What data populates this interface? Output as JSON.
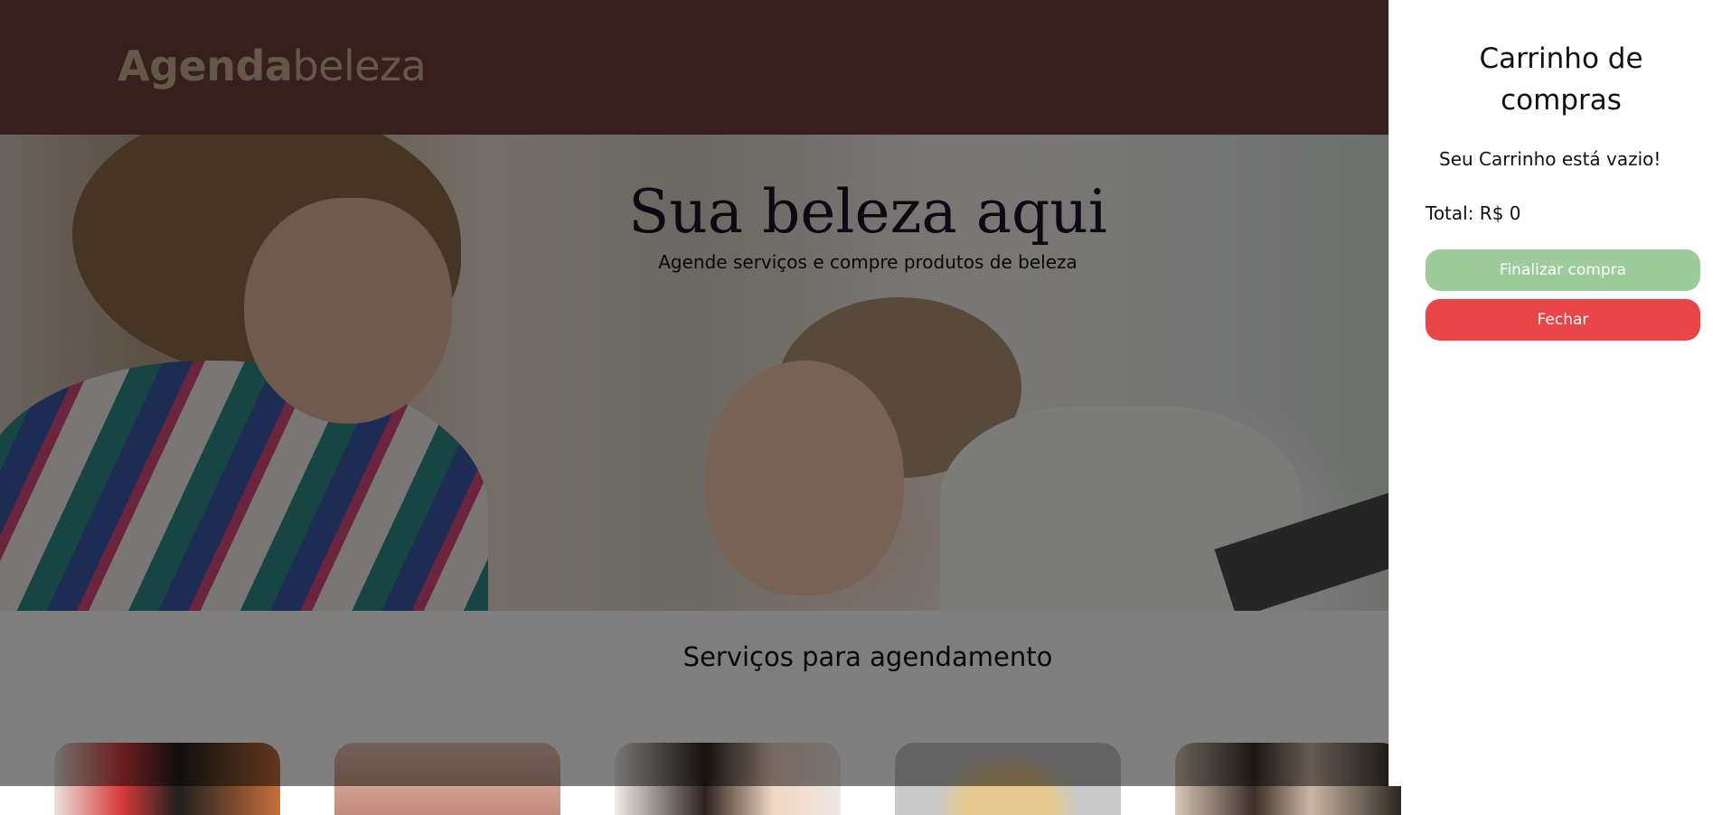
{
  "header": {
    "logo_bold": "Agenda",
    "logo_light": "beleza",
    "background": "#733d3c",
    "logo_color": "#c8b18e"
  },
  "hero": {
    "title": "Sua beleza aqui",
    "subtitle": "Agende serviços e compre produtos de beleza"
  },
  "services": {
    "title": "Serviços para agendamento"
  },
  "cart": {
    "title": "Carrinho de compras",
    "empty_message": "Seu Carrinho está vazio!",
    "total_label": "Total: R$ 0",
    "finalize_label": "Finalizar compra",
    "close_label": "Fechar",
    "finalize_color": "#9ccc9a",
    "close_color": "#e94446"
  }
}
